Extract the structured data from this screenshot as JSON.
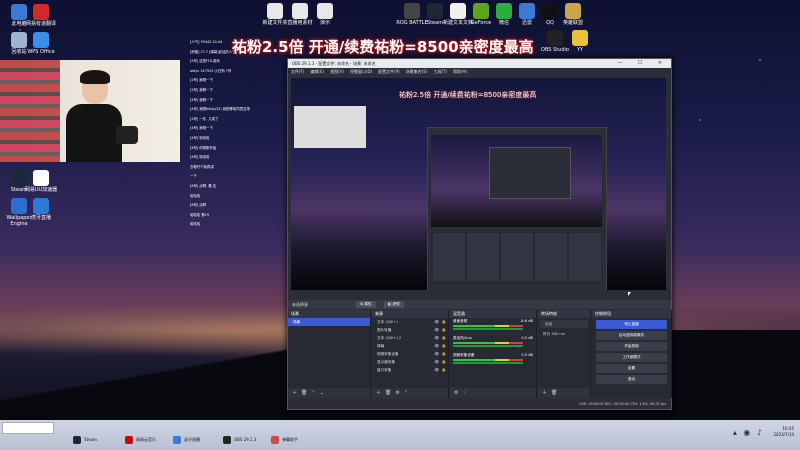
{
  "banner": "祐粉2.5倍 开通/续费祐粉=8500亲密度最高",
  "desktop_icons_left": [
    {
      "label": "此电脑",
      "color": "#3b7bd6"
    },
    {
      "label": "网易有道翻译",
      "color": "#d12a2a"
    },
    {
      "label": "回收站",
      "color": "#9fb4cc"
    },
    {
      "label": "WPS Office",
      "color": "#3a8ee6"
    },
    {
      "label": "Steam",
      "color": "#1b2838"
    },
    {
      "label": "网易UU加速器",
      "color": "#ffffff"
    },
    {
      "label": "Wallpaper Engine",
      "color": "#2b6fcf"
    },
    {
      "label": "虎牙直播",
      "color": "#2b7bd6"
    }
  ],
  "desktop_icons_top": [
    {
      "label": "新建文件夹",
      "color": "#e8e8e8"
    },
    {
      "label": "直播用素材",
      "color": "#e8e8e8"
    },
    {
      "label": "演示",
      "color": "#e8e8e8"
    },
    {
      "label": "ROG BATTLE",
      "color": "#444444"
    },
    {
      "label": "Steam",
      "color": "#1b2838"
    },
    {
      "label": "新建文本文档",
      "color": "#f0f0f0"
    },
    {
      "label": "GeForce",
      "color": "#5fa31b"
    },
    {
      "label": "微信",
      "color": "#2aae3c"
    },
    {
      "label": "迅雷",
      "color": "#3b7bd6"
    },
    {
      "label": "QQ",
      "color": "#111111"
    },
    {
      "label": "英雄联盟",
      "color": "#c9a64a"
    }
  ],
  "desktop_icons_right": [
    {
      "label": "OBS Studio",
      "color": "#222222"
    },
    {
      "label": "YY",
      "color": "#e8c23a"
    }
  ],
  "chat": [
    "[人气] 39443  10:44",
    "[房管] 27.7 [弹幕]说话的人了",
    "[2号] 这是什么游戏",
    "oldyu 147525 小白狗 7号",
    "[2号] 我刚一下",
    "[2号] 我刚一下",
    "[4号] 我刚一下",
    "[4号] 我刚Ninja(33) 我刚等哈同意这场",
    "[2号] 一件, 几成了",
    "[4号] 我刚一下",
    "[4号] 哈哈哈",
    "[4号] 你刚刚开始",
    "[4号] 哈哈哈",
    "去哪开个版再讲",
    "一下",
    "[6号] 点啊, 看 这",
    "哈哈哈",
    "[6号] 点啊",
    "哈哈哈 第19",
    "哈哈哈"
  ],
  "obs": {
    "title": "OBS 29.1.3 - 配置文件: 未命名 - 场景: 未命名",
    "window_buttons": "—  ☐  ✕",
    "menu": [
      "文件(F)",
      "编辑(E)",
      "视图(V)",
      "停靠窗口(D)",
      "配置文件(P)",
      "场景集合(S)",
      "工具(T)",
      "帮助(H)"
    ],
    "source_label": "未选择源",
    "props_btn": "⚙ 属性",
    "filter_btn": "◧ 滤镜",
    "scenes": {
      "title": "场景",
      "items": [
        "场景"
      ]
    },
    "sources": {
      "title": "来源",
      "items": [
        "文本 (GDI+)",
        "图片轮播",
        "文本 (GDI+) 2",
        "弹幕",
        "视频采集设备",
        "显示器采集",
        "窗口采集"
      ]
    },
    "mixer": {
      "title": "混音器",
      "items": [
        {
          "name": "桌面音频",
          "db": "-8.6 dB"
        },
        {
          "name": "麦克风/Aux",
          "db": "0.0 dB"
        },
        {
          "name": "视频采集设备",
          "db": "0.0 dB"
        }
      ]
    },
    "transitions": {
      "title": "转场特效",
      "type": "淡出",
      "duration_label": "时长",
      "duration": "300 ms"
    },
    "controls": {
      "title": "控制按钮",
      "buttons": [
        "停止直播",
        "启动虚拟摄像机",
        "开始录制",
        "工作室模式",
        "设置",
        "退出"
      ]
    },
    "status": "LIVE: 00:00:00    REC: 00:00:00    CPU: 1.8%, 60.00 fps"
  },
  "taskbar": {
    "items": [
      {
        "label": "Steam",
        "color": "#1b2838"
      },
      {
        "label": "网易云音乐",
        "color": "#c20c0c"
      },
      {
        "label": "虎牙直播",
        "color": "#3b7bd6"
      },
      {
        "label": "OBS 29.1.3",
        "color": "#222222"
      },
      {
        "label": "弹幕助手",
        "color": "#d04a4a"
      }
    ],
    "time": "10:45",
    "date": "2023/7/14"
  }
}
